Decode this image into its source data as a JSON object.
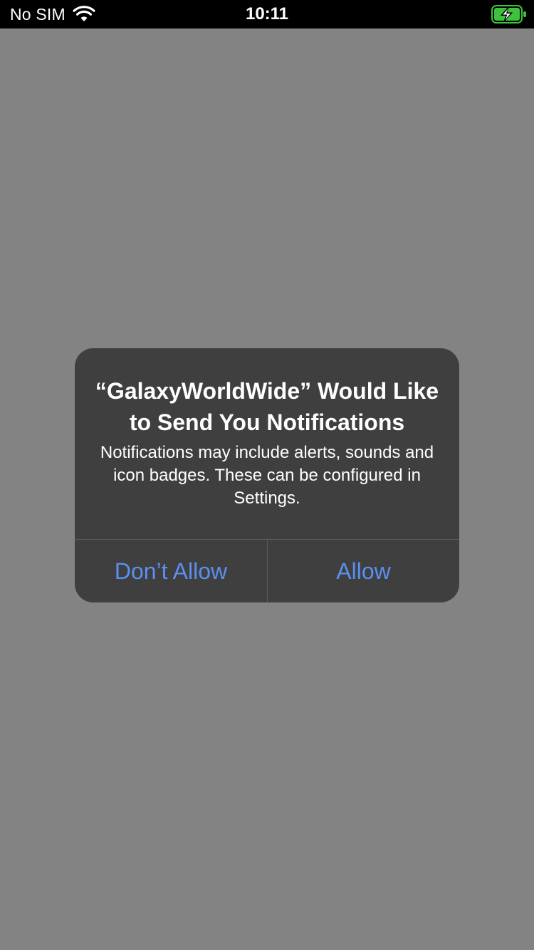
{
  "status_bar": {
    "carrier": "No SIM",
    "time": "10:11",
    "wifi_icon": "wifi-icon",
    "battery_icon": "battery-charging-icon",
    "battery_color": "#3ec23e"
  },
  "alert": {
    "title": "“GalaxyWorldWide” Would Like to Send You Notifications",
    "message": "Notifications may include alerts, sounds and icon badges. These can be configured in Settings.",
    "deny_label": "Don’t Allow",
    "allow_label": "Allow",
    "button_color": "#5b8ff0",
    "background_color": "#3f3f3f"
  },
  "backdrop_color": "#838383"
}
